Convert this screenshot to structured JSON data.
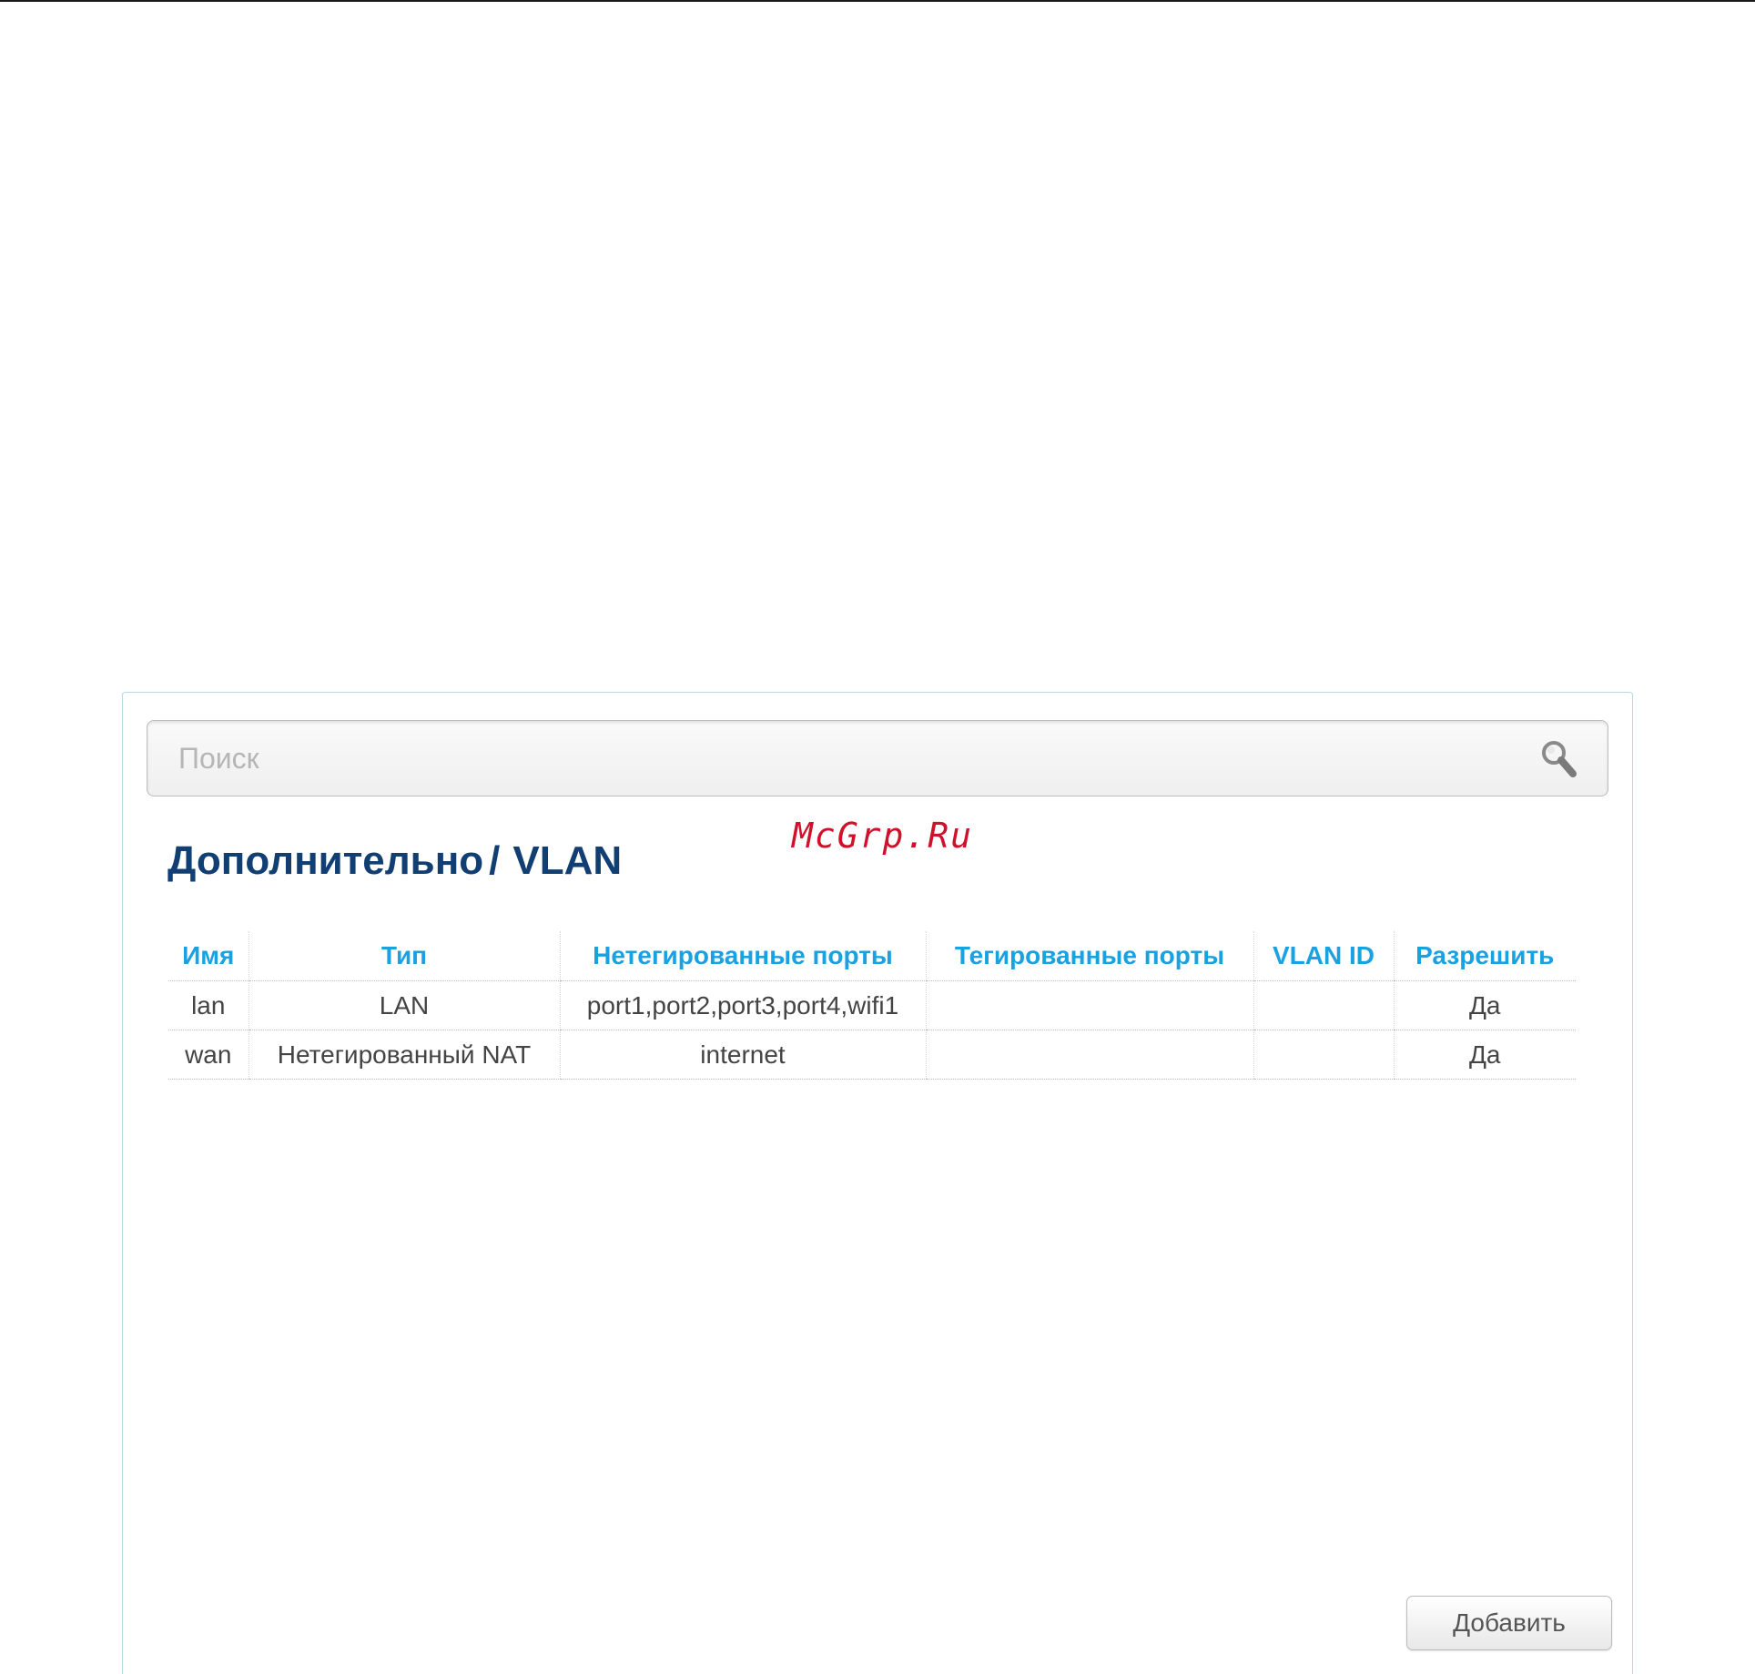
{
  "watermark": "McGrp.Ru",
  "search": {
    "placeholder": "Поиск",
    "value": "",
    "icon": "search-icon"
  },
  "breadcrumb": {
    "section": "Дополнительно",
    "separator": "/",
    "page": "VLAN"
  },
  "table": {
    "columns": [
      "Имя",
      "Тип",
      "Нетегированные порты",
      "Тегированные порты",
      "VLAN ID",
      "Разрешить"
    ],
    "rows": [
      {
        "name": "lan",
        "type": "LAN",
        "untagged": "port1,port2,port3,port4,wifi1",
        "tagged": "",
        "vlan_id": "",
        "enabled": "Да"
      },
      {
        "name": "wan",
        "type": "Нетегированный NAT",
        "untagged": "internet",
        "tagged": "",
        "vlan_id": "",
        "enabled": "Да"
      }
    ]
  },
  "actions": {
    "add_label": "Добавить"
  },
  "colors": {
    "title": "#123f73",
    "header": "#1aa1e1",
    "watermark": "#d0112b",
    "panel_border": "#b9d8e2"
  }
}
